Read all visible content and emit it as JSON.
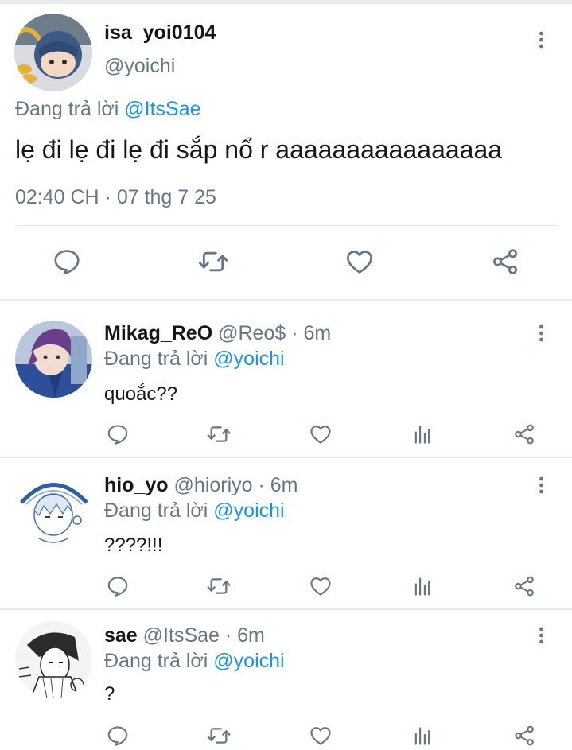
{
  "main_tweet": {
    "display_name": "isa_yoi0104",
    "handle": "@yoichi",
    "reply_prefix": "Đang trả lời ",
    "reply_to": "@ItsSae",
    "text": "lẹ đi lẹ đi lẹ đi sắp nổ r aaaaaaaaaaaaaaaa",
    "timestamp": "02:40 CH · 07 thg 7 25"
  },
  "replies": [
    {
      "display_name": "Mikag_ReO",
      "handle_time": "@Reo$ · 6m",
      "reply_prefix": "Đang trả lời ",
      "reply_to": "@yoichi",
      "text": "quoắc??"
    },
    {
      "display_name": "hio_yo",
      "handle_time": "@hioriyo · 6m",
      "reply_prefix": "Đang trả lời ",
      "reply_to": "@yoichi",
      "text": "????!!!"
    },
    {
      "display_name": "sae",
      "handle_time": "@ItsSae · 6m",
      "reply_prefix": "Đang trả lời ",
      "reply_to": "@yoichi",
      "text": "?"
    }
  ],
  "colors": {
    "accent": "#1b95e0",
    "secondary_text": "#657786",
    "icon": "#657786",
    "divider": "#e6ecf0"
  },
  "icons": [
    "more-vertical-icon",
    "reply-icon",
    "retweet-icon",
    "like-icon",
    "analytics-icon",
    "share-icon"
  ]
}
